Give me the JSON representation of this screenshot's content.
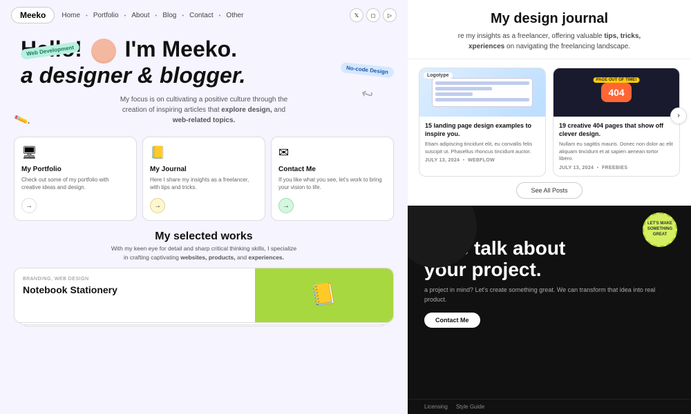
{
  "left": {
    "nav": {
      "logo": "Meeko",
      "links": [
        "Home",
        "Portfolio",
        "About",
        "Blog",
        "Contact",
        "Other"
      ],
      "icons": [
        "𝕏",
        "📷",
        "▶"
      ]
    },
    "hero": {
      "greeting": "Hello!",
      "name": "I'm Meeko.",
      "subtitle": "a designer & blogger.",
      "badge_web": "Web Development",
      "badge_nocode": "No-code Design",
      "description": "My focus is on cultivating a positive culture through the creation of inspiring articles that",
      "desc_bold1": "explore design,",
      "desc_and": "and",
      "desc_bold2": "web-related topics."
    },
    "cards": [
      {
        "icon": "🖥",
        "title": "My Portfolio",
        "desc": "Check out some of my portfolio with creative ideas and design.",
        "arrow": "→"
      },
      {
        "icon": "📒",
        "title": "My Journal",
        "desc": "Here I share my insights as a freelancer, with tips and tricks.",
        "arrow": "→"
      },
      {
        "icon": "✉",
        "title": "Contact Me",
        "desc": "If you like what you see, let's work to bring your vision to life.",
        "arrow": "→"
      }
    ],
    "works": {
      "title": "My selected works",
      "desc": "With my keen eye for detail and sharp critical thinking skills, I specialize in crafting captivating",
      "bold1": "websites,",
      "bold2": "products,",
      "and": "and",
      "bold3": "experiences."
    },
    "notebook": {
      "tag": "Branding, Web Design",
      "name": "Notebook Stationery"
    }
  },
  "right": {
    "journal": {
      "title": "My design journal",
      "desc_start": "re my insights as a freelancer, offering valuable",
      "bold1": "tips, tricks,",
      "desc_mid": "xperiences",
      "desc_end": "on navigating the freelancing landscape."
    },
    "blog_cards": [
      {
        "id": "card1",
        "tag": "Logotype",
        "title": "15 landing page design examples to inspire you.",
        "desc": "Etiam adipiscing tincidunt elit, eu convallis felis suscipit ut. Phasellus rhoncus tincidunt auctor.",
        "date": "July 13, 2024",
        "category": "Webflow"
      },
      {
        "id": "card2",
        "tag": "PAGE OUT OF TIME!",
        "title": "19 creative 404 pages that show off clever design.",
        "desc": "Nullam eu sagittis mauris. Donec non dolor ac elit aliquam tincidunt et at sapien aenean tortor libero.",
        "date": "July 13, 2024",
        "category": "Freebies"
      }
    ],
    "see_all": "See All Posts",
    "cta": {
      "bubble_text": "• • •",
      "title_line1": "Let's talk about",
      "title_line2": "your project.",
      "desc": "a project in mind? Let's create something great. We can transform that idea into real product.",
      "button": "Contact Me",
      "badge_line1": "LET'S MAKE",
      "badge_line2": "SOMETHING",
      "badge_line3": "GREAT"
    },
    "footer": {
      "links": [
        "Licensing",
        "Style Guide"
      ]
    }
  }
}
